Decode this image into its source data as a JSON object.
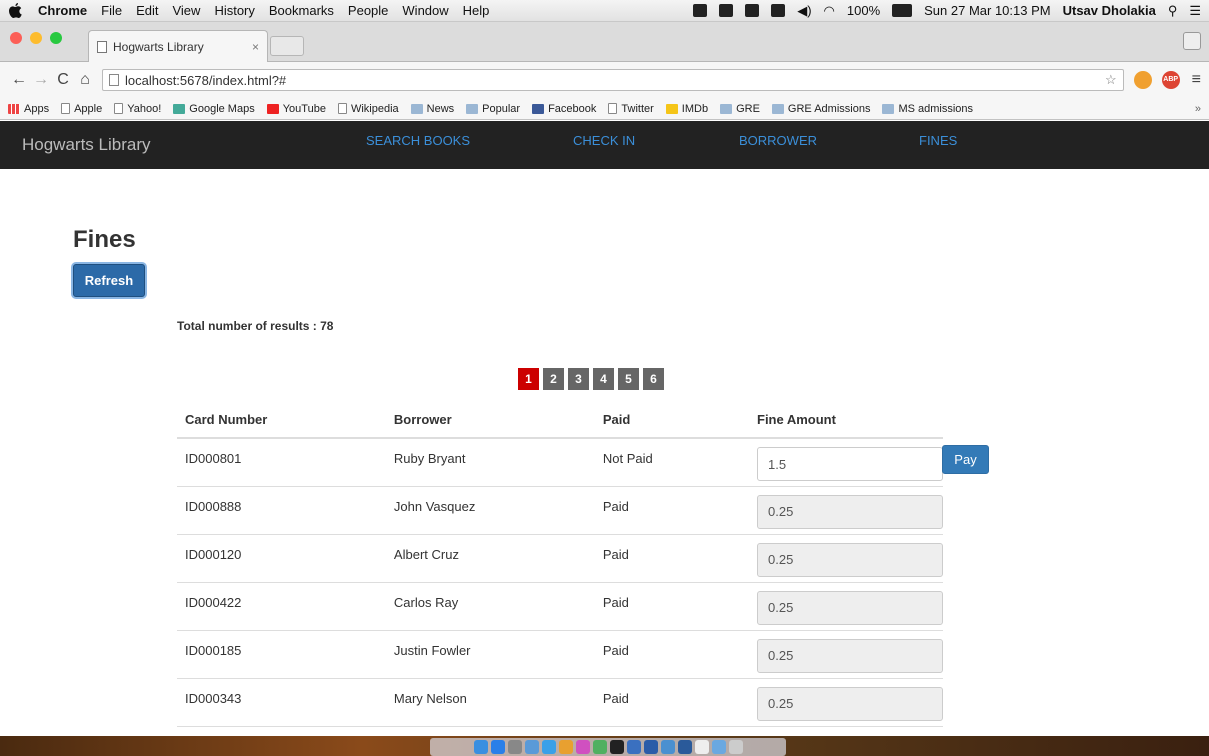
{
  "menubar": {
    "app_name": "Chrome",
    "items": [
      "File",
      "Edit",
      "View",
      "History",
      "Bookmarks",
      "People",
      "Window",
      "Help"
    ],
    "battery": "100%",
    "datetime": "Sun 27 Mar  10:13 PM",
    "user": "Utsav Dholakia"
  },
  "browser": {
    "tab_title": "Hogwarts Library",
    "url": "localhost:5678/index.html?#",
    "bookmarks": [
      "Apps",
      "Apple",
      "Yahoo!",
      "Google Maps",
      "YouTube",
      "Wikipedia",
      "News",
      "Popular",
      "Facebook",
      "Twitter",
      "IMDb",
      "GRE",
      "GRE Admissions",
      "MS admissions"
    ],
    "bookmarks_more": "»"
  },
  "navbar": {
    "brand": "Hogwarts Library",
    "links": [
      "SEARCH BOOKS",
      "CHECK IN",
      "BORROWER",
      "FINES"
    ]
  },
  "page": {
    "title": "Fines",
    "refresh_label": "Refresh",
    "total_label": "Total number of results : 78",
    "pages": [
      "1",
      "2",
      "3",
      "4",
      "5",
      "6"
    ],
    "active_page": "1",
    "pay_label": "Pay"
  },
  "table": {
    "headers": [
      "Card Number",
      "Borrower",
      "Paid",
      "Fine Amount"
    ],
    "rows": [
      {
        "card": "ID000801",
        "borrower": "Ruby Bryant",
        "paid": "Not Paid",
        "amount": "1.5"
      },
      {
        "card": "ID000888",
        "borrower": "John Vasquez",
        "paid": "Paid",
        "amount": "0.25"
      },
      {
        "card": "ID000120",
        "borrower": "Albert Cruz",
        "paid": "Paid",
        "amount": "0.25"
      },
      {
        "card": "ID000422",
        "borrower": "Carlos Ray",
        "paid": "Paid",
        "amount": "0.25"
      },
      {
        "card": "ID000185",
        "borrower": "Justin Fowler",
        "paid": "Paid",
        "amount": "0.25"
      },
      {
        "card": "ID000343",
        "borrower": "Mary Nelson",
        "paid": "Paid",
        "amount": "0.25"
      }
    ]
  },
  "colors": {
    "navbar_bg": "#222222",
    "nav_link": "#3b8fd9",
    "primary_button": "#337ab7",
    "active_page": "#cc0000",
    "inactive_page": "#666666"
  }
}
